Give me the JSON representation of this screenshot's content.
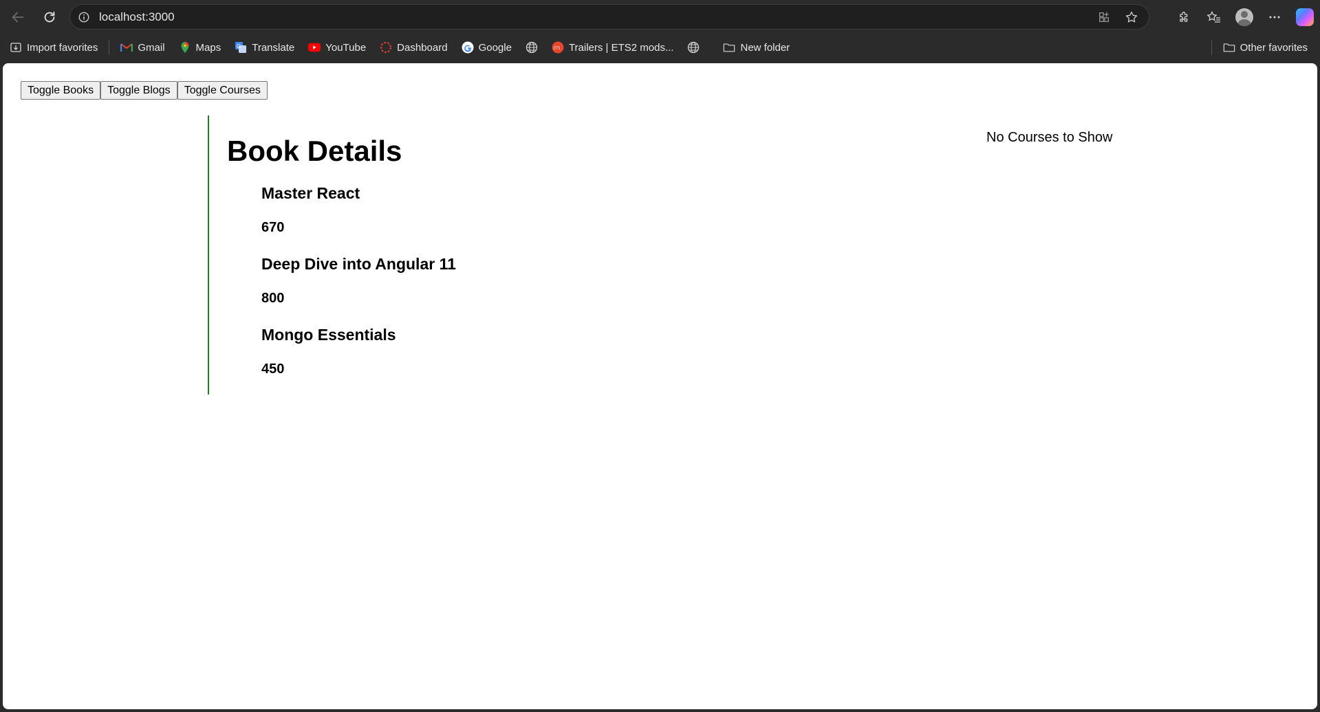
{
  "browser": {
    "url": "localhost:3000",
    "bookmarks": [
      {
        "label": "Import favorites",
        "icon": "import-icon"
      },
      {
        "label": "Gmail",
        "icon": "gmail-icon"
      },
      {
        "label": "Maps",
        "icon": "maps-icon"
      },
      {
        "label": "Translate",
        "icon": "translate-icon"
      },
      {
        "label": "YouTube",
        "icon": "youtube-icon"
      },
      {
        "label": "Dashboard",
        "icon": "dashboard-icon"
      },
      {
        "label": "Google",
        "icon": "google-icon"
      },
      {
        "label": "",
        "icon": "globe-icon"
      },
      {
        "label": "Trailers | ETS2 mods...",
        "icon": "trailers-icon"
      },
      {
        "label": "",
        "icon": "globe-icon"
      },
      {
        "label": "New folder",
        "icon": "folder-icon"
      }
    ],
    "other_favorites": "Other favorites"
  },
  "page": {
    "buttons": {
      "toggle_books": "Toggle Books",
      "toggle_blogs": "Toggle Blogs",
      "toggle_courses": "Toggle Courses"
    },
    "books": {
      "heading": "Book Details",
      "items": [
        {
          "title": "Master React",
          "price": "670"
        },
        {
          "title": "Deep Dive into Angular 11",
          "price": "800"
        },
        {
          "title": "Mongo Essentials",
          "price": "450"
        }
      ]
    },
    "courses_message": "No Courses to Show"
  },
  "colors": {
    "chrome_bg": "#2b2b2b",
    "books_border": "#1e7d1e"
  }
}
